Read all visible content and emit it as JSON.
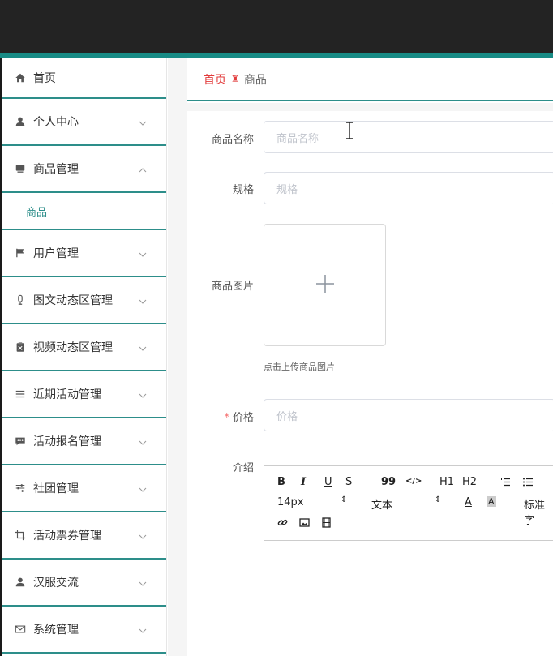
{
  "sidebar": {
    "items": [
      {
        "label": "首页",
        "icon": "home-icon"
      },
      {
        "label": "个人中心",
        "icon": "user-icon"
      },
      {
        "label": "商品管理",
        "icon": "monitor-icon",
        "expanded": true,
        "children": [
          {
            "label": "商品"
          }
        ]
      },
      {
        "label": "用户管理",
        "icon": "flag-icon"
      },
      {
        "label": "图文动态区管理",
        "icon": "mic-icon"
      },
      {
        "label": "视频动态区管理",
        "icon": "clipboard-icon"
      },
      {
        "label": "近期活动管理",
        "icon": "list-icon"
      },
      {
        "label": "活动报名管理",
        "icon": "chat-icon"
      },
      {
        "label": "社团管理",
        "icon": "sliders-icon"
      },
      {
        "label": "活动票券管理",
        "icon": "crop-icon"
      },
      {
        "label": "汉服交流",
        "icon": "user-icon"
      },
      {
        "label": "系统管理",
        "icon": "mail-icon"
      }
    ]
  },
  "breadcrumb": {
    "home": "首页",
    "current": "商品"
  },
  "form": {
    "name": {
      "label": "商品名称",
      "placeholder": "商品名称"
    },
    "spec": {
      "label": "规格",
      "placeholder": "规格"
    },
    "image": {
      "label": "商品图片",
      "tip": "点击上传商品图片"
    },
    "price": {
      "label": "价格",
      "placeholder": "价格",
      "required": "*"
    },
    "intro": {
      "label": "介绍"
    }
  },
  "editor": {
    "buttons": [
      "B",
      "I",
      "U",
      "S",
      "99",
      "</>",
      "H1",
      "H2"
    ],
    "font_size": "14px",
    "header_select": "文本",
    "color_btn": "A",
    "bg_btn": "A",
    "align_select": "标准字"
  },
  "colors": {
    "accent": "#2d8e8a",
    "crumb": "#e23b3b",
    "topbar": "#232323"
  }
}
